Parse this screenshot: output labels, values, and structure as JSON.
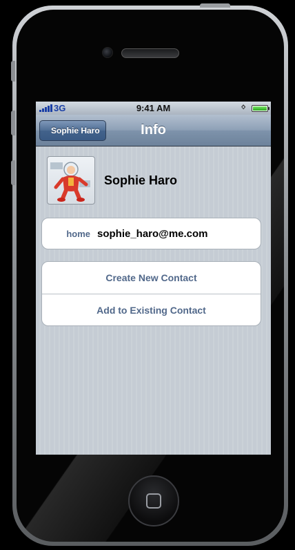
{
  "status_bar": {
    "network": "3G",
    "time": "9:41 AM",
    "bluetooth_icon": "bluetooth-icon",
    "battery_level": 1.0
  },
  "nav_bar": {
    "back_label": "Sophie Haro",
    "title": "Info"
  },
  "contact": {
    "name": "Sophie Haro",
    "avatar_icon": "astronaut-avatar"
  },
  "email": {
    "label": "home",
    "value": "sophie_haro@me.com"
  },
  "actions": {
    "create": "Create New Contact",
    "add_existing": "Add to Existing Contact"
  },
  "colors": {
    "link_text": "#51688a",
    "carrier_blue": "#1a3fa6",
    "nav_bar": "#8da0b6"
  }
}
